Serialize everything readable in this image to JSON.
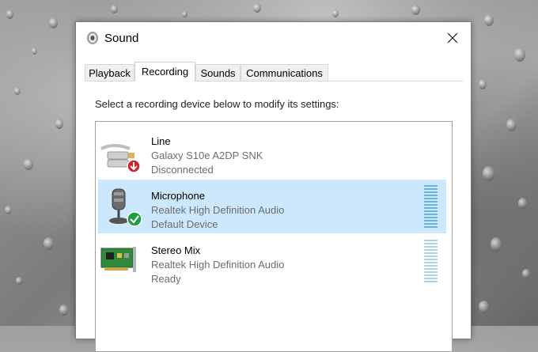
{
  "window": {
    "title": "Sound"
  },
  "tabs": [
    {
      "label": "Playback",
      "active": false
    },
    {
      "label": "Recording",
      "active": true
    },
    {
      "label": "Sounds",
      "active": false
    },
    {
      "label": "Communications",
      "active": false
    }
  ],
  "instruction": "Select a recording device below to modify its settings:",
  "devices": [
    {
      "name": "Line",
      "description": "Galaxy S10e A2DP SNK",
      "status": "Disconnected",
      "icon": "line-in-icon",
      "badge": "red-down-arrow",
      "selected": false
    },
    {
      "name": "Microphone",
      "description": "Realtek High Definition Audio",
      "status": "Default Device",
      "icon": "microphone-icon",
      "badge": "green-check",
      "selected": true
    },
    {
      "name": "Stereo Mix",
      "description": "Realtek High Definition Audio",
      "status": "Ready",
      "icon": "sound-card-icon",
      "badge": "",
      "selected": false
    }
  ],
  "colors": {
    "selection": "#cce8ff",
    "meter": "#6fb3d9",
    "default_badge": "#1e9e3e",
    "disconnected_badge": "#d4232a"
  }
}
